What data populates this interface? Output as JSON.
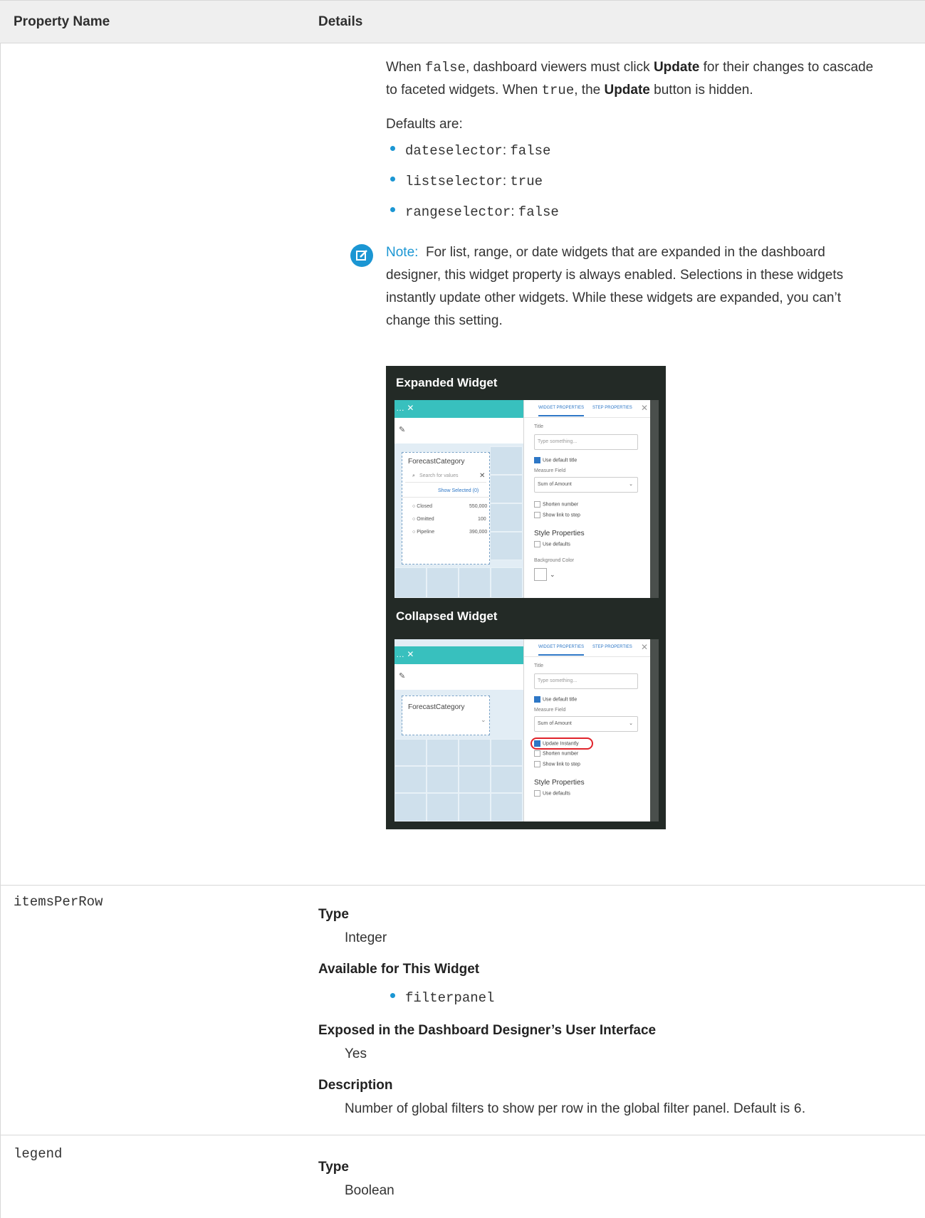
{
  "table": {
    "col1_header": "Property Name",
    "col2_header": "Details"
  },
  "intro": {
    "line1_a": "When ",
    "line1_code_false": "false",
    "line1_b": ", dashboard viewers must click ",
    "line1_update": "Update",
    "line1_c": " for their changes to cascade",
    "line2_a": "to faceted widgets. When ",
    "line2_code_true": "true",
    "line2_b": ", the ",
    "line2_update": "Update",
    "line2_c": " button is hidden."
  },
  "defaults_label": "Defaults are:",
  "defaults": [
    {
      "name": "dateselector",
      "sep": ": ",
      "value": "false"
    },
    {
      "name": "listselector",
      "sep": ": ",
      "value": "true"
    },
    {
      "name": "rangeselector",
      "sep": ": ",
      "value": "false"
    }
  ],
  "note": {
    "label": "Note:",
    "line1": "For list, range, or date widgets that are expanded in the dashboard",
    "line2": "designer, this widget property is always enabled. Selections in these widgets",
    "line3": "instantly update other widgets. While these widgets are expanded, you can’t",
    "line4": "change this setting."
  },
  "screenshot": {
    "expanded_title": "Expanded Widget",
    "collapsed_title": "Collapsed Widget",
    "tab_widget": "WIDGET PROPERTIES",
    "tab_step": "STEP PROPERTIES",
    "title_label": "Title",
    "title_placeholder": "Type something...",
    "use_default_title": "Use default title",
    "measure_field": "Measure Field",
    "measure_value": "Sum of Amount",
    "update_instantly": "Update Instantly",
    "shorten_number": "Shorten number",
    "show_link": "Show link to step",
    "style_properties": "Style Properties",
    "use_defaults": "Use defaults",
    "background_color": "Background Color",
    "widget_title": "ForecastCategory",
    "search_placeholder": "Search for values",
    "show_selected": "Show Selected (0)",
    "list_items": [
      {
        "label": "Closed",
        "value": "550,000"
      },
      {
        "label": "Omitted",
        "value": "100"
      },
      {
        "label": "Pipeline",
        "value": "390,000"
      }
    ]
  },
  "items_per_row": {
    "name": "itemsPerRow",
    "type_label": "Type",
    "type_value": "Integer",
    "available_label": "Available for This Widget",
    "available_items": [
      "filterpanel"
    ],
    "exposed_label": "Exposed in the Dashboard Designer’s User Interface",
    "exposed_value": "Yes",
    "description_label": "Description",
    "description_text": "Number of global filters to show per row in the global filter panel. Default is ",
    "description_code": "6",
    "description_end": "."
  },
  "legend": {
    "name": "legend",
    "type_label": "Type",
    "type_value": "Boolean"
  }
}
